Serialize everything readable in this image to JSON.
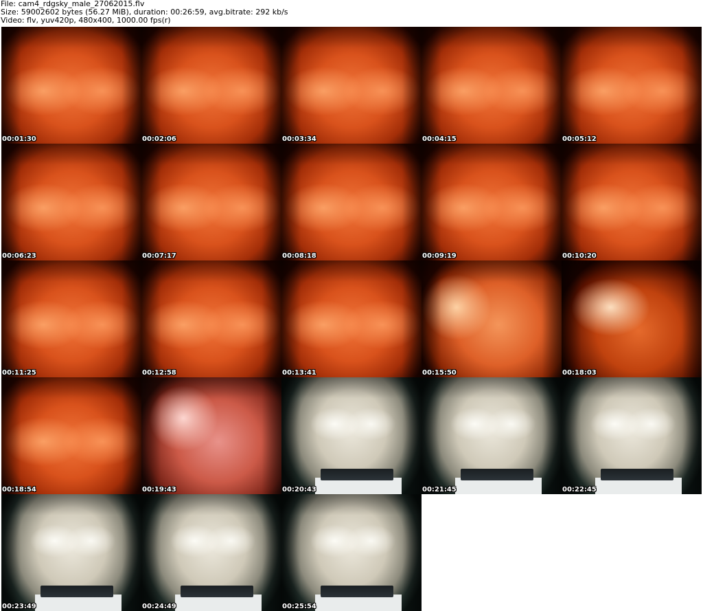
{
  "header": {
    "file_line": "File: cam4_rdgsky_male_27062015.flv",
    "size_line": "Size: 59002602 bytes (56.27 MiB), duration: 00:26:59, avg.bitrate: 292 kb/s",
    "video_line": "Video: flv, yuv420p, 480x400, 1000.00 fps(r)"
  },
  "thumbnails": [
    {
      "timestamp": "00:01:30",
      "tone": "warm"
    },
    {
      "timestamp": "00:02:06",
      "tone": "warm"
    },
    {
      "timestamp": "00:03:34",
      "tone": "warm"
    },
    {
      "timestamp": "00:04:15",
      "tone": "warm"
    },
    {
      "timestamp": "00:05:12",
      "tone": "warm"
    },
    {
      "timestamp": "00:06:23",
      "tone": "warm"
    },
    {
      "timestamp": "00:07:17",
      "tone": "warm"
    },
    {
      "timestamp": "00:08:18",
      "tone": "warm"
    },
    {
      "timestamp": "00:09:19",
      "tone": "warm"
    },
    {
      "timestamp": "00:10:20",
      "tone": "warm"
    },
    {
      "timestamp": "00:11:25",
      "tone": "warm"
    },
    {
      "timestamp": "00:12:58",
      "tone": "warm"
    },
    {
      "timestamp": "00:13:41",
      "tone": "warm"
    },
    {
      "timestamp": "00:15:50",
      "tone": "warm bright"
    },
    {
      "timestamp": "00:18:03",
      "tone": "warm dark"
    },
    {
      "timestamp": "00:18:54",
      "tone": "warm"
    },
    {
      "timestamp": "00:19:43",
      "tone": "pink"
    },
    {
      "timestamp": "00:20:43",
      "tone": "pale"
    },
    {
      "timestamp": "00:21:45",
      "tone": "pale"
    },
    {
      "timestamp": "00:22:45",
      "tone": "pale"
    },
    {
      "timestamp": "00:23:49",
      "tone": "pale"
    },
    {
      "timestamp": "00:24:49",
      "tone": "pale"
    },
    {
      "timestamp": "00:25:54",
      "tone": "pale"
    }
  ]
}
